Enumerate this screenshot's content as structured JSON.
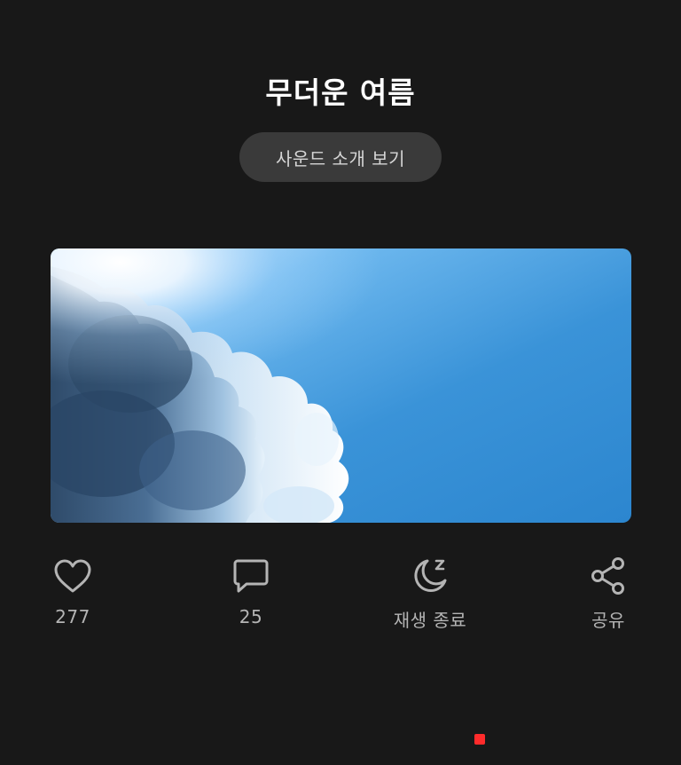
{
  "title": "무더운 여름",
  "intro_button": {
    "label": "사운드 소개 보기"
  },
  "image": {
    "subject": "sky-with-clouds"
  },
  "actions": [
    {
      "id": "like",
      "icon": "heart-icon",
      "label": "277"
    },
    {
      "id": "comment",
      "icon": "comment-icon",
      "label": "25"
    },
    {
      "id": "sleep_timer",
      "icon": "moon-sleep-icon",
      "label": "재생 종료"
    },
    {
      "id": "share",
      "icon": "share-icon",
      "label": "공유"
    }
  ],
  "colors": {
    "background": "#181818",
    "button_bg": "#3a3a3a",
    "icon": "#b4b4b4",
    "recording_indicator": "#ff2b2b"
  }
}
